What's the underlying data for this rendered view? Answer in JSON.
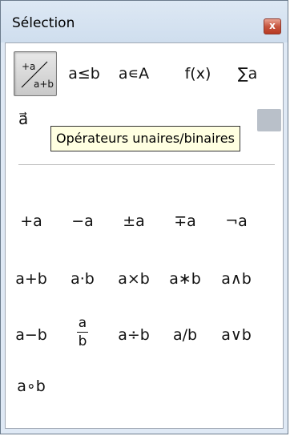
{
  "window": {
    "title": "Sélection",
    "close_glyph": "x"
  },
  "categories": [
    {
      "label": "+a/a+b",
      "icon": "unary-binary-fraction-icon",
      "selected": true
    },
    {
      "label": "a≤b"
    },
    {
      "label": "a∊A"
    },
    {
      "label": "f(x)"
    },
    {
      "label": "∑a"
    }
  ],
  "second_row": {
    "first_label": "a⃗"
  },
  "tooltip": {
    "text": "Opérateurs unaires/binaires"
  },
  "symbols": {
    "row1": [
      "+a",
      "−a",
      "±a",
      "∓a",
      "¬a"
    ],
    "row2": [
      "a+b",
      "a·b",
      "a×b",
      "a∗b",
      "a∧b"
    ],
    "row3": [
      "a−b",
      "a/b-fraction",
      "a÷b",
      "a/b",
      "a∨b"
    ],
    "row4": [
      "a∘b"
    ],
    "fraction": {
      "num": "a",
      "den": "b"
    }
  },
  "colors": {
    "window_bg": "#dfe9f5",
    "close_red": "#c7563f",
    "tooltip_bg": "#ffffe1"
  }
}
